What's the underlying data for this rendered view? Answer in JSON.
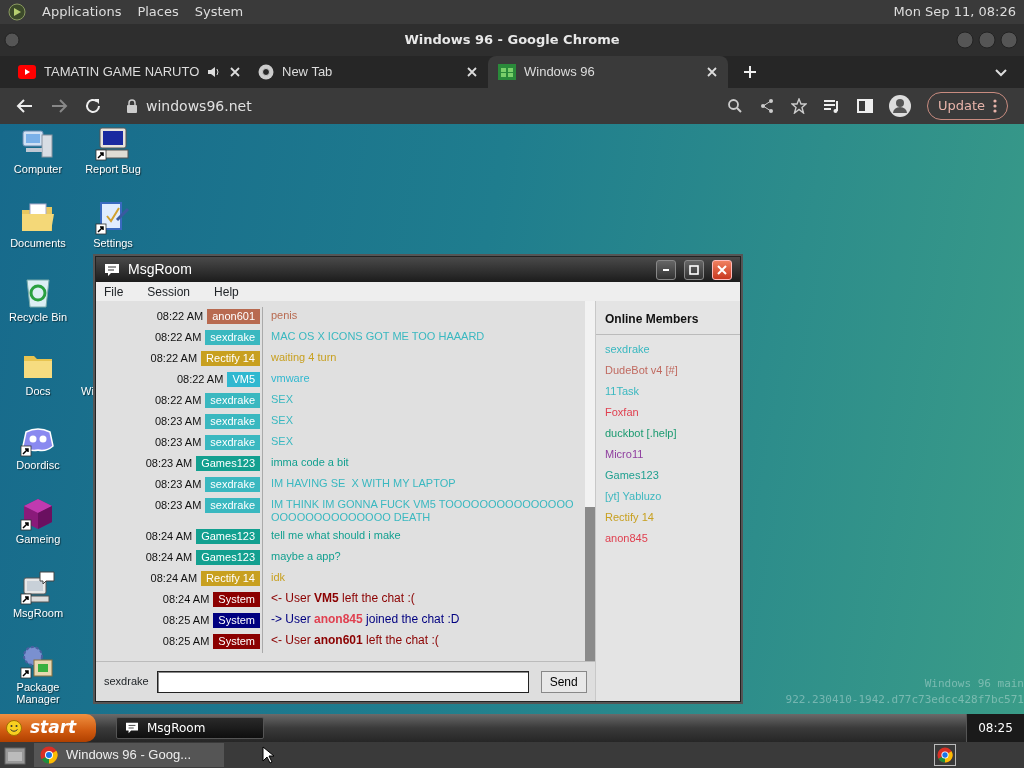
{
  "top_panel": {
    "menus": [
      "Applications",
      "Places",
      "System"
    ],
    "clock": "Mon Sep 11, 08:26"
  },
  "browser": {
    "title": "Windows 96 - Google Chrome",
    "tabs": [
      {
        "label": "TAMATIN GAME NARUTO",
        "kind": "video",
        "audio": true,
        "selected": false
      },
      {
        "label": "New Tab",
        "kind": "chrome",
        "audio": false,
        "selected": false
      },
      {
        "label": "Windows 96",
        "kind": "site",
        "audio": false,
        "selected": true
      }
    ],
    "url": "windows96.net",
    "update_button": "Update"
  },
  "desktop": {
    "icons": [
      {
        "label": "Computer",
        "kind": "computer",
        "shortcut": false
      },
      {
        "label": "Documents",
        "kind": "documents",
        "shortcut": false
      },
      {
        "label": "Recycle Bin",
        "kind": "recycle",
        "shortcut": false
      },
      {
        "label": "Docs",
        "kind": "folder",
        "shortcut": false
      },
      {
        "label": "Doordisc",
        "kind": "doordisc",
        "shortcut": true
      },
      {
        "label": "Gameing",
        "kind": "cube",
        "shortcut": true
      },
      {
        "label": "MsgRoom",
        "kind": "msgroom",
        "shortcut": true
      },
      {
        "label": "Package Manager",
        "kind": "package",
        "shortcut": true
      },
      {
        "label": "Report Bug",
        "kind": "monitor",
        "shortcut": true
      },
      {
        "label": "Settings",
        "kind": "settings",
        "shortcut": true
      },
      {
        "label": "Wi",
        "kind": "covered"
      }
    ],
    "watermark": [
      "Windows 96 main",
      "922.230410-1942.d77c73edcc428f7bc571"
    ]
  },
  "msgroom": {
    "title": "MsgRoom",
    "menus": [
      "File",
      "Session",
      "Help"
    ],
    "messages": [
      {
        "kind": "chat",
        "time": "08:22 AM",
        "user": "anon601",
        "color": "#b86a50",
        "text": "penis"
      },
      {
        "kind": "chat",
        "time": "08:22 AM",
        "user": "sexdrake",
        "color": "#3ab8c0",
        "text": "MAC OS X ICONS GOT ME TOO HAAARD"
      },
      {
        "kind": "chat",
        "time": "08:22 AM",
        "user": "Rectify 14",
        "color": "#c8a020",
        "text": "waiting 4 turn"
      },
      {
        "kind": "chat",
        "time": "08:22 AM",
        "user": "VM5",
        "color": "#30b8d0",
        "text": "vmware"
      },
      {
        "kind": "chat",
        "time": "08:22 AM",
        "user": "sexdrake",
        "color": "#3ab8c0",
        "text": "SEX"
      },
      {
        "kind": "chat",
        "time": "08:23 AM",
        "user": "sexdrake",
        "color": "#3ab8c0",
        "text": "SEX"
      },
      {
        "kind": "chat",
        "time": "08:23 AM",
        "user": "sexdrake",
        "color": "#3ab8c0",
        "text": "SEX"
      },
      {
        "kind": "chat",
        "time": "08:23 AM",
        "user": "Games123",
        "color": "#13a090",
        "text": "imma code a bit"
      },
      {
        "kind": "chat",
        "time": "08:23 AM",
        "user": "sexdrake",
        "color": "#3ab8c0",
        "text": "IM HAVING SE  X WITH MY LAPTOP"
      },
      {
        "kind": "chat",
        "time": "08:23 AM",
        "user": "sexdrake",
        "color": "#3ab8c0",
        "text": "IM THINK IM GONNA FUCK VM5 TOOOOOOOOOOOOOOOOOOOOOOOOOOOOO DEATH"
      },
      {
        "kind": "chat",
        "time": "08:24 AM",
        "user": "Games123",
        "color": "#13a090",
        "text": "tell me what should i make"
      },
      {
        "kind": "chat",
        "time": "08:24 AM",
        "user": "Games123",
        "color": "#13a090",
        "text": "maybe a app?"
      },
      {
        "kind": "chat",
        "time": "08:24 AM",
        "user": "Rectify 14",
        "color": "#c8a020",
        "text": "idk"
      },
      {
        "kind": "system",
        "time": "08:24 AM",
        "user": "System",
        "color": "#8b0000",
        "prefix": "<- User",
        "highlight": {
          "label": "VM5",
          "color": "#8b0000"
        },
        "suffix": "left the chat :("
      },
      {
        "kind": "system",
        "time": "08:25 AM",
        "user": "System",
        "color": "#000080",
        "prefix": "-> User",
        "highlight": {
          "label": "anon845",
          "color": "#e04050"
        },
        "suffix": "joined the chat :D"
      },
      {
        "kind": "system",
        "time": "08:25 AM",
        "user": "System",
        "color": "#8b0000",
        "prefix": "<- User",
        "highlight": {
          "label": "anon601",
          "color": "#8b0000"
        },
        "suffix": "left the chat :("
      }
    ],
    "input_label": "sexdrake",
    "send_button": "Send",
    "members_title": "Online Members",
    "members": [
      {
        "name": "sexdrake",
        "color": "#3ab8c0"
      },
      {
        "name": "DudeBot v4 [#]",
        "color": "#c06a60"
      },
      {
        "name": "11Task",
        "color": "#3ab8c0"
      },
      {
        "name": "Foxfan",
        "color": "#e04050"
      },
      {
        "name": "duckbot [.help]",
        "color": "#1a9a70"
      },
      {
        "name": "Micro11",
        "color": "#9040a0"
      },
      {
        "name": "Games123",
        "color": "#20a090"
      },
      {
        "name": "[yt] Yabluzo",
        "color": "#40b8c0"
      },
      {
        "name": "Rectify 14",
        "color": "#c8a020"
      },
      {
        "name": "anon845",
        "color": "#e04050"
      }
    ]
  },
  "win96_taskbar": {
    "start": "start",
    "tasks": [
      "MsgRoom"
    ],
    "clock": "08:25"
  },
  "bottom_panel": {
    "windows": [
      "Windows 96 - Goog..."
    ]
  }
}
